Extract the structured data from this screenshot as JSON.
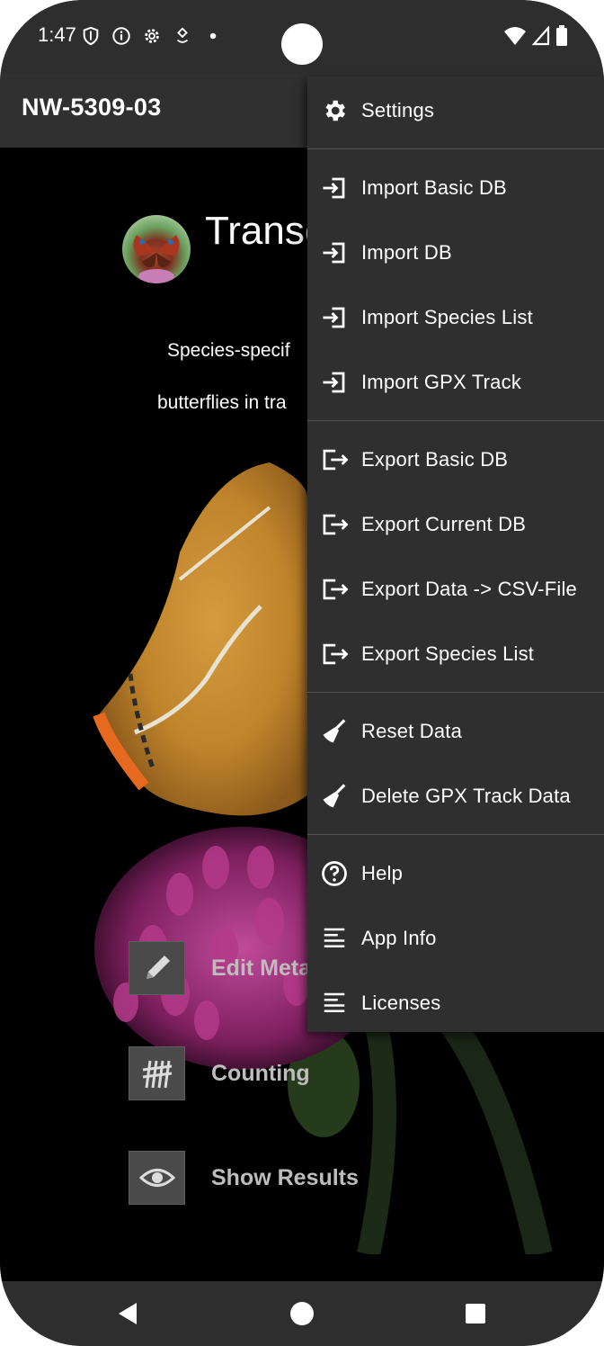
{
  "status_bar": {
    "time": "1:47"
  },
  "app_bar": {
    "title": "NW-5309-03"
  },
  "main": {
    "title": "Transe",
    "description_line1": "Species-specif",
    "description_line2": "butterflies in tra",
    "actions": [
      {
        "label": "Edit Meta",
        "icon": "pencil-icon"
      },
      {
        "label": "Counting",
        "icon": "tally-icon"
      },
      {
        "label": "Show Results",
        "icon": "eye-icon"
      }
    ]
  },
  "menu": {
    "groups": [
      [
        {
          "label": "Settings",
          "icon": "gear-icon"
        }
      ],
      [
        {
          "label": "Import Basic DB",
          "icon": "import-icon"
        },
        {
          "label": "Import DB",
          "icon": "import-icon"
        },
        {
          "label": "Import Species List",
          "icon": "import-icon"
        },
        {
          "label": "Import GPX Track",
          "icon": "import-icon"
        }
      ],
      [
        {
          "label": "Export Basic DB",
          "icon": "export-icon"
        },
        {
          "label": "Export Current DB",
          "icon": "export-icon"
        },
        {
          "label": "Export Data -> CSV-File",
          "icon": "export-icon"
        },
        {
          "label": "Export Species List",
          "icon": "export-icon"
        }
      ],
      [
        {
          "label": "Reset Data",
          "icon": "broom-icon"
        },
        {
          "label": "Delete GPX Track Data",
          "icon": "broom-icon"
        }
      ],
      [
        {
          "label": "Help",
          "icon": "help-icon"
        },
        {
          "label": "App Info",
          "icon": "lines-icon"
        },
        {
          "label": "Licenses",
          "icon": "lines-icon"
        }
      ]
    ]
  },
  "colors": {
    "menu_bg": "#2f2f2f",
    "bar_bg": "#303030",
    "action_label": "#bdbdbd"
  }
}
